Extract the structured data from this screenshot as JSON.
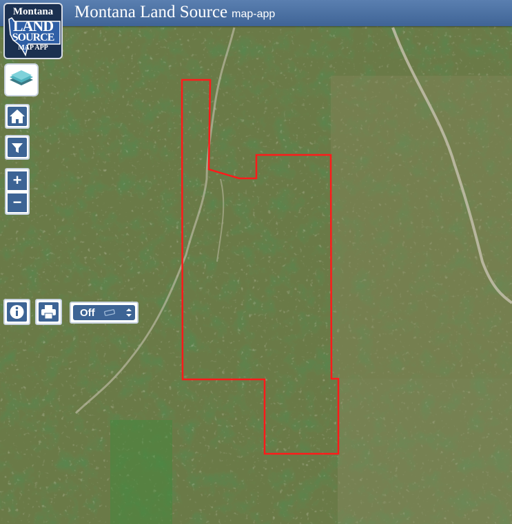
{
  "app": {
    "title": "Montana Land Source",
    "subtitle": "map-app"
  },
  "logo": {
    "line1": "Montana",
    "line2": "LAND",
    "line3": "SOURCE",
    "line4": "MAP APP"
  },
  "toolbar": {
    "layers_icon": "layers-icon",
    "home_icon": "home-icon",
    "filter_icon": "filter-icon",
    "zoom_in_label": "+",
    "zoom_out_label": "−",
    "info_icon": "info-icon",
    "print_icon": "print-icon"
  },
  "layer_select": {
    "value": "Off"
  },
  "colors": {
    "header": "#4a70a3",
    "button_blue": "#3d6495",
    "boundary": "#ff1a1a"
  }
}
